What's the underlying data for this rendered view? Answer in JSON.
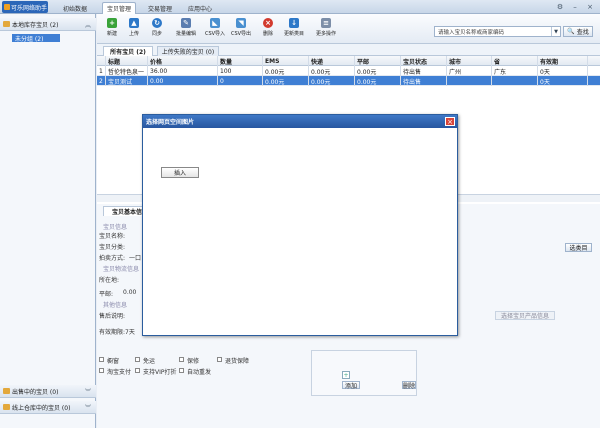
{
  "topbar": {
    "brand": "可乐网络助手",
    "nav": [
      "初始数据",
      "宝贝管理",
      "交易管理",
      "应用中心"
    ],
    "active_nav": 1
  },
  "left": {
    "groups": [
      {
        "label": "本地库存宝贝 (2)"
      },
      {
        "label": "出售中的宝贝 (0)"
      },
      {
        "label": "线上仓库中的宝贝 (0)"
      }
    ],
    "selected_item": "未分组 (2)"
  },
  "toolbar": {
    "buttons": [
      {
        "label": "新建",
        "icon": "add-icon",
        "color": "#3aa33a",
        "glyph": "+"
      },
      {
        "label": "上传",
        "icon": "upload-icon",
        "color": "#2d78c8",
        "glyph": "▲"
      },
      {
        "label": "同步",
        "icon": "sync-icon",
        "color": "#2d78c8",
        "glyph": "↻"
      },
      {
        "label": "批量编辑",
        "icon": "batch-edit-icon",
        "color": "#5a7db0",
        "glyph": "✎"
      },
      {
        "label": "CSV导入",
        "icon": "csv-import-icon",
        "color": "#4a90d0",
        "glyph": "◣"
      },
      {
        "label": "CSV导出",
        "icon": "csv-export-icon",
        "color": "#4a90d0",
        "glyph": "◥"
      },
      {
        "label": "删除",
        "icon": "delete-icon",
        "color": "#d23a2e",
        "glyph": "×"
      },
      {
        "label": "更新类目",
        "icon": "update-category-icon",
        "color": "#2d78c8",
        "glyph": "↓"
      },
      {
        "label": "更多操作",
        "icon": "more-icon",
        "color": "#7c8ea8",
        "glyph": "≡"
      }
    ],
    "search_placeholder": "请输入宝贝名称或商家编码",
    "search_button": "查找"
  },
  "subtabs": [
    "所有宝贝 (2)",
    "上传失败的宝贝 (0)"
  ],
  "grid": {
    "headers": [
      "",
      "标题",
      "价格",
      "数量",
      "EMS",
      "快递",
      "平邮",
      "宝贝状态",
      "城市",
      "省",
      "有效期"
    ],
    "rows": [
      [
        "1",
        "哲伦特色泉一",
        "36.00",
        "100",
        "0.00元",
        "0.00元",
        "0.00元",
        "待出售",
        "广州",
        "广东",
        "0天"
      ],
      [
        "2",
        "宝贝测试",
        "0.00",
        "0",
        "0.00元",
        "0.00元",
        "0.00元",
        "待出售",
        "",
        "",
        "0天"
      ]
    ]
  },
  "detail": {
    "tab": "宝贝基本信",
    "labels": {
      "basic": "宝贝信息",
      "name": "宝贝名称:",
      "category": "宝贝分类:",
      "auction": "拍卖方式:",
      "auction_value": "一口",
      "logistics": "宝贝物流信息",
      "location": "所在地:",
      "post": "平邮:",
      "post_value": "0.00",
      "other": "其他信息",
      "after_sale": "售后说明:",
      "valid_period": "有效期限:",
      "valid_value": "7天",
      "select_cat": "选类目",
      "choose_product": "选择宝贝产品信息",
      "add_img": "添加",
      "delete_img": "删除"
    },
    "checkboxes": [
      "橱窗",
      "免运",
      "保修",
      "退货保障",
      "淘宝支付",
      "支持VIP打折",
      "自动重发"
    ]
  },
  "dialog": {
    "title": "选择网页空间图片",
    "insert_button": "插入"
  }
}
